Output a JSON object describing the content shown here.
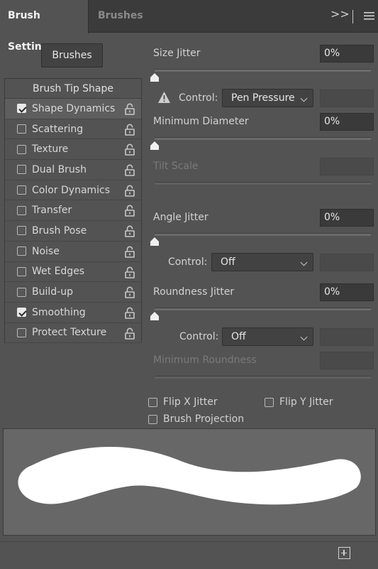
{
  "tabs": {
    "active": "Brush Settings",
    "inactive": "Brushes"
  },
  "toolbar": {
    "expand_glyph": ">>",
    "menu_glyph": "≡"
  },
  "brushes_button": "Brushes",
  "list": {
    "header": "Brush Tip Shape",
    "items": [
      {
        "label": "Shape Dynamics",
        "checked": true,
        "selected": true
      },
      {
        "label": "Scattering",
        "checked": false
      },
      {
        "label": "Texture",
        "checked": false
      },
      {
        "label": "Dual Brush",
        "checked": false
      },
      {
        "label": "Color Dynamics",
        "checked": false
      },
      {
        "label": "Transfer",
        "checked": false
      },
      {
        "label": "Brush Pose",
        "checked": false
      },
      {
        "label": "Noise",
        "checked": false
      },
      {
        "label": "Wet Edges",
        "checked": false
      },
      {
        "label": "Build-up",
        "checked": false
      },
      {
        "label": "Smoothing",
        "checked": true
      },
      {
        "label": "Protect Texture",
        "checked": false
      }
    ]
  },
  "settings": {
    "size_jitter": {
      "label": "Size Jitter",
      "value": "0%",
      "slider": 0
    },
    "size_control": {
      "label": "Control:",
      "value": "Pen Pressure"
    },
    "min_diameter": {
      "label": "Minimum Diameter",
      "value": "0%",
      "slider": 0
    },
    "tilt_scale": {
      "label": "Tilt Scale"
    },
    "angle_jitter": {
      "label": "Angle Jitter",
      "value": "0%",
      "slider": 0
    },
    "angle_control": {
      "label": "Control:",
      "value": "Off"
    },
    "roundness_jitter": {
      "label": "Roundness Jitter",
      "value": "0%",
      "slider": 0
    },
    "roundness_control": {
      "label": "Control:",
      "value": "Off"
    },
    "min_roundness": {
      "label": "Minimum Roundness"
    }
  },
  "options": {
    "flip_x": "Flip X Jitter",
    "flip_y": "Flip Y Jitter",
    "projection": "Brush Projection"
  },
  "colors": {
    "panel": "#535353",
    "tabbar": "#3b3b3b",
    "preview_bg": "#676767",
    "stroke": "#ffffff"
  }
}
